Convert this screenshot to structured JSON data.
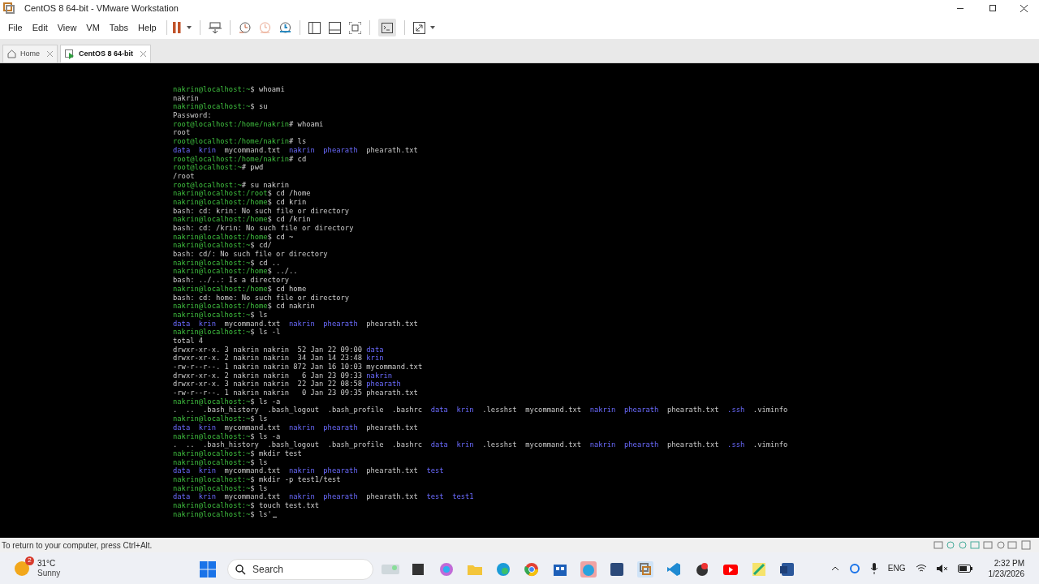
{
  "window": {
    "title": "CentOS 8 64-bit - VMware Workstation"
  },
  "menu": [
    "File",
    "Edit",
    "View",
    "VM",
    "Tabs",
    "Help"
  ],
  "tabs": [
    {
      "label": "Home",
      "selected": false,
      "kind": "home"
    },
    {
      "label": "CentOS 8 64-bit",
      "selected": true,
      "kind": "vm"
    }
  ],
  "terminal": {
    "lines": [
      {
        "kind": "prompt",
        "prompt": "nakrin@localhost:~",
        "command": "$ whoami"
      },
      {
        "kind": "text",
        "text": "nakrin"
      },
      {
        "kind": "prompt",
        "prompt": "nakrin@localhost:~",
        "command": "$ su"
      },
      {
        "kind": "text",
        "text": "Password:"
      },
      {
        "kind": "prompt",
        "prompt": "root@localhost:/home/nakrin",
        "command": "# whoami"
      },
      {
        "kind": "text",
        "text": "root"
      },
      {
        "kind": "prompt",
        "prompt": "root@localhost:/home/nakrin",
        "command": "# ls"
      },
      {
        "kind": "listing",
        "entries": [
          {
            "text": "data",
            "kind": "dir"
          },
          {
            "text": "krin",
            "kind": "dir"
          },
          {
            "text": "mycommand.txt",
            "kind": "file"
          },
          {
            "text": "nakrin",
            "kind": "dir"
          },
          {
            "text": "phearath",
            "kind": "dir"
          },
          {
            "text": "phearath.txt",
            "kind": "file"
          }
        ]
      },
      {
        "kind": "prompt",
        "prompt": "root@localhost:/home/nakrin",
        "command": "# cd"
      },
      {
        "kind": "prompt",
        "prompt": "root@localhost:~",
        "command": "# pwd"
      },
      {
        "kind": "text",
        "text": "/root"
      },
      {
        "kind": "prompt",
        "prompt": "root@localhost:~",
        "command": "# su nakrin"
      },
      {
        "kind": "prompt",
        "prompt": "nakrin@localhost:/root",
        "command": "$ cd /home"
      },
      {
        "kind": "prompt",
        "prompt": "nakrin@localhost:/home",
        "command": "$ cd krin"
      },
      {
        "kind": "text",
        "text": "bash: cd: krin: No such file or directory"
      },
      {
        "kind": "prompt",
        "prompt": "nakrin@localhost:/home",
        "command": "$ cd /krin"
      },
      {
        "kind": "text",
        "text": "bash: cd: /krin: No such file or directory"
      },
      {
        "kind": "prompt",
        "prompt": "nakrin@localhost:/home",
        "command": "$ cd ~"
      },
      {
        "kind": "prompt",
        "prompt": "nakrin@localhost:~",
        "command": "$ cd/"
      },
      {
        "kind": "text",
        "text": "bash: cd/: No such file or directory"
      },
      {
        "kind": "prompt",
        "prompt": "nakrin@localhost:~",
        "command": "$ cd .."
      },
      {
        "kind": "prompt",
        "prompt": "nakrin@localhost:/home",
        "command": "$ ../.."
      },
      {
        "kind": "text",
        "text": "bash: ../..: Is a directory"
      },
      {
        "kind": "prompt",
        "prompt": "nakrin@localhost:/home",
        "command": "$ cd home"
      },
      {
        "kind": "text",
        "text": "bash: cd: home: No such file or directory"
      },
      {
        "kind": "prompt",
        "prompt": "nakrin@localhost:/home",
        "command": "$ cd nakrin"
      },
      {
        "kind": "prompt",
        "prompt": "nakrin@localhost:~",
        "command": "$ ls"
      },
      {
        "kind": "listing",
        "entries": [
          {
            "text": "data",
            "kind": "dir"
          },
          {
            "text": "krin",
            "kind": "dir"
          },
          {
            "text": "mycommand.txt",
            "kind": "file"
          },
          {
            "text": "nakrin",
            "kind": "dir"
          },
          {
            "text": "phearath",
            "kind": "dir"
          },
          {
            "text": "phearath.txt",
            "kind": "file"
          }
        ]
      },
      {
        "kind": "prompt",
        "prompt": "nakrin@localhost:~",
        "command": "$ ls -l"
      },
      {
        "kind": "text",
        "text": "total 4"
      },
      {
        "kind": "long",
        "info": "drwxr-xr-x. 3 nakrin nakrin  52 Jan 22 09:00",
        "name": {
          "text": "data",
          "kind": "dir"
        }
      },
      {
        "kind": "long",
        "info": "drwxr-xr-x. 2 nakrin nakrin  34 Jan 14 23:48",
        "name": {
          "text": "krin",
          "kind": "dir"
        }
      },
      {
        "kind": "long",
        "info": "-rw-r--r--. 1 nakrin nakrin 872 Jan 16 10:03",
        "name": {
          "text": "mycommand.txt",
          "kind": "file"
        }
      },
      {
        "kind": "long",
        "info": "drwxr-xr-x. 2 nakrin nakrin   6 Jan 23 09:33",
        "name": {
          "text": "nakrin",
          "kind": "dir"
        }
      },
      {
        "kind": "long",
        "info": "drwxr-xr-x. 3 nakrin nakrin  22 Jan 22 08:58",
        "name": {
          "text": "phearath",
          "kind": "dir"
        }
      },
      {
        "kind": "long",
        "info": "-rw-r--r--. 1 nakrin nakrin   0 Jan 23 09:35",
        "name": {
          "text": "phearath.txt",
          "kind": "file"
        }
      },
      {
        "kind": "prompt",
        "prompt": "nakrin@localhost:~",
        "command": "$ ls -a"
      },
      {
        "kind": "listing",
        "entries": [
          {
            "text": ".",
            "kind": "file"
          },
          {
            "text": "..",
            "kind": "file"
          },
          {
            "text": ".bash_history",
            "kind": "file"
          },
          {
            "text": ".bash_logout",
            "kind": "file"
          },
          {
            "text": ".bash_profile",
            "kind": "file"
          },
          {
            "text": ".bashrc",
            "kind": "file"
          },
          {
            "text": "data",
            "kind": "dir"
          },
          {
            "text": "krin",
            "kind": "dir"
          },
          {
            "text": ".lesshst",
            "kind": "file"
          },
          {
            "text": "mycommand.txt",
            "kind": "file"
          },
          {
            "text": "nakrin",
            "kind": "dir"
          },
          {
            "text": "phearath",
            "kind": "dir"
          },
          {
            "text": "phearath.txt",
            "kind": "file"
          },
          {
            "text": ".ssh",
            "kind": "dir"
          },
          {
            "text": ".viminfo",
            "kind": "file"
          }
        ]
      },
      {
        "kind": "prompt",
        "prompt": "nakrin@localhost:~",
        "command": "$ ls"
      },
      {
        "kind": "listing",
        "entries": [
          {
            "text": "data",
            "kind": "dir"
          },
          {
            "text": "krin",
            "kind": "dir"
          },
          {
            "text": "mycommand.txt",
            "kind": "file"
          },
          {
            "text": "nakrin",
            "kind": "dir"
          },
          {
            "text": "phearath",
            "kind": "dir"
          },
          {
            "text": "phearath.txt",
            "kind": "file"
          }
        ]
      },
      {
        "kind": "prompt",
        "prompt": "nakrin@localhost:~",
        "command": "$ ls -a"
      },
      {
        "kind": "listing",
        "entries": [
          {
            "text": ".",
            "kind": "file"
          },
          {
            "text": "..",
            "kind": "file"
          },
          {
            "text": ".bash_history",
            "kind": "file"
          },
          {
            "text": ".bash_logout",
            "kind": "file"
          },
          {
            "text": ".bash_profile",
            "kind": "file"
          },
          {
            "text": ".bashrc",
            "kind": "file"
          },
          {
            "text": "data",
            "kind": "dir"
          },
          {
            "text": "krin",
            "kind": "dir"
          },
          {
            "text": ".lesshst",
            "kind": "file"
          },
          {
            "text": "mycommand.txt",
            "kind": "file"
          },
          {
            "text": "nakrin",
            "kind": "dir"
          },
          {
            "text": "phearath",
            "kind": "dir"
          },
          {
            "text": "phearath.txt",
            "kind": "file"
          },
          {
            "text": ".ssh",
            "kind": "dir"
          },
          {
            "text": ".viminfo",
            "kind": "file"
          }
        ]
      },
      {
        "kind": "prompt",
        "prompt": "nakrin@localhost:~",
        "command": "$ mkdir test"
      },
      {
        "kind": "prompt",
        "prompt": "nakrin@localhost:~",
        "command": "$ ls"
      },
      {
        "kind": "listing",
        "entries": [
          {
            "text": "data",
            "kind": "dir"
          },
          {
            "text": "krin",
            "kind": "dir"
          },
          {
            "text": "mycommand.txt",
            "kind": "file"
          },
          {
            "text": "nakrin",
            "kind": "dir"
          },
          {
            "text": "phearath",
            "kind": "dir"
          },
          {
            "text": "phearath.txt",
            "kind": "file"
          },
          {
            "text": "test",
            "kind": "dir"
          }
        ]
      },
      {
        "kind": "prompt",
        "prompt": "nakrin@localhost:~",
        "command": "$ mkdir -p test1/test"
      },
      {
        "kind": "prompt",
        "prompt": "nakrin@localhost:~",
        "command": "$ ls"
      },
      {
        "kind": "listing",
        "entries": [
          {
            "text": "data",
            "kind": "dir"
          },
          {
            "text": "krin",
            "kind": "dir"
          },
          {
            "text": "mycommand.txt",
            "kind": "file"
          },
          {
            "text": "nakrin",
            "kind": "dir"
          },
          {
            "text": "phearath",
            "kind": "dir"
          },
          {
            "text": "phearath.txt",
            "kind": "file"
          },
          {
            "text": "test",
            "kind": "dir"
          },
          {
            "text": "test1",
            "kind": "dir"
          }
        ]
      },
      {
        "kind": "prompt",
        "prompt": "nakrin@localhost:~",
        "command": "$ touch test.txt"
      },
      {
        "kind": "prompt",
        "prompt": "nakrin@localhost:~",
        "command": "$ ls'",
        "cursor": true
      }
    ]
  },
  "status_bar": {
    "text": "To return to your computer, press Ctrl+Alt."
  },
  "taskbar": {
    "weather": {
      "temperature": "31°C",
      "condition": "Sunny",
      "badge": "2"
    },
    "search": {
      "placeholder": "Search"
    },
    "language": "ENG",
    "time": "2:32 PM",
    "date": "1/23/2026"
  }
}
